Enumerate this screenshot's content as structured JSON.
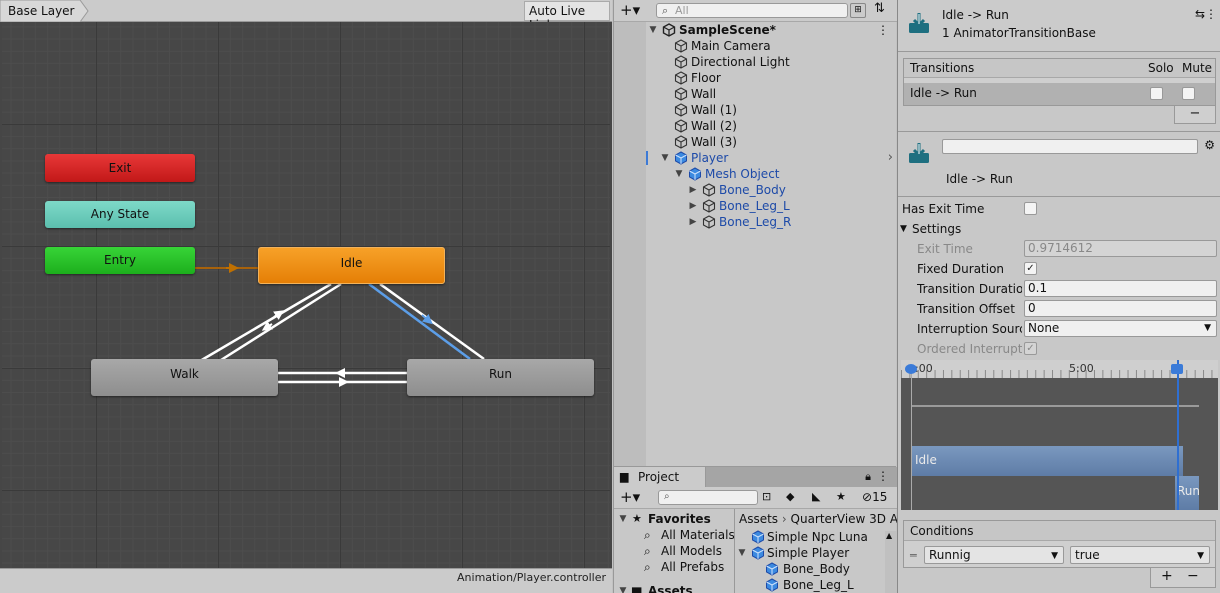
{
  "animator": {
    "breadcrumb": "Base Layer",
    "auto_live_link": "Auto Live Link",
    "states": {
      "exit": "Exit",
      "any_state": "Any State",
      "entry": "Entry",
      "idle": "Idle",
      "walk": "Walk",
      "run": "Run"
    },
    "controller_path": "Animation/Player.controller",
    "colors": {
      "exit": "#d32222",
      "any_state": "#6fcdbb",
      "entry": "#27c227",
      "idle": "#f08e14",
      "default_state": "#9b9b9b",
      "selected_transition": "#5c9ee8"
    }
  },
  "hierarchy": {
    "search_placeholder": "All",
    "scene": "SampleScene*",
    "items": [
      {
        "label": "Main Camera"
      },
      {
        "label": "Directional Light"
      },
      {
        "label": "Floor"
      },
      {
        "label": "Wall"
      },
      {
        "label": "Wall (1)"
      },
      {
        "label": "Wall (2)"
      },
      {
        "label": "Wall (3)"
      },
      {
        "label": "Player"
      },
      {
        "label": "Mesh Object"
      },
      {
        "label": "Bone_Body"
      },
      {
        "label": "Bone_Leg_L"
      },
      {
        "label": "Bone_Leg_R"
      }
    ]
  },
  "project": {
    "tab": "Project",
    "hidden_count": "15",
    "favorites_label": "Favorites",
    "favorites": [
      "All Materials",
      "All Models",
      "All Prefabs"
    ],
    "assets_partial": "Assets",
    "breadcrumb_root": "Assets",
    "breadcrumb_child": "QuarterView 3D A",
    "items": [
      "Simple Npc Luna",
      "Simple Player",
      "Bone_Body",
      "Bone_Leg_L"
    ]
  },
  "inspector": {
    "title": "Idle -> Run",
    "subtitle": "1 AnimatorTransitionBase",
    "transitions_header": "Transitions",
    "solo_header": "Solo",
    "mute_header": "Mute",
    "transition_row": "Idle -> Run",
    "name_value": "",
    "transition_label": "Idle -> Run",
    "has_exit_time_label": "Has Exit Time",
    "settings_label": "Settings",
    "exit_time_label": "Exit Time",
    "exit_time_value": "0.9714612",
    "fixed_duration_label": "Fixed Duration",
    "transition_duration_label": "Transition Duration",
    "transition_duration_value": "0.1",
    "transition_offset_label": "Transition Offset",
    "transition_offset_value": "0",
    "interruption_source_label": "Interruption Source",
    "interruption_source_value": "None",
    "ordered_interruption_label": "Ordered Interruption",
    "timeline": {
      "tick_0": ":00",
      "tick_1": "5:00",
      "idle_label": "Idle",
      "run_label": "Run"
    },
    "conditions_header": "Conditions",
    "condition_param": "Runnig",
    "condition_value": "true"
  }
}
